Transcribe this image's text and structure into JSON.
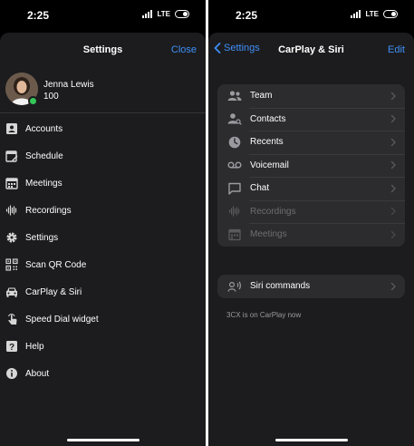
{
  "status_bar": {
    "time": "2:25",
    "network": "LTE"
  },
  "left_screen": {
    "title": "Settings",
    "close_label": "Close",
    "profile": {
      "name": "Jenna Lewis",
      "extension": "100",
      "presence": "available"
    },
    "menu": [
      {
        "label": "Accounts",
        "icon": "accounts-icon"
      },
      {
        "label": "Schedule",
        "icon": "schedule-icon"
      },
      {
        "label": "Meetings",
        "icon": "meetings-icon"
      },
      {
        "label": "Recordings",
        "icon": "recordings-icon"
      },
      {
        "label": "Settings",
        "icon": "gear-icon"
      },
      {
        "label": "Scan QR Code",
        "icon": "qr-code-icon"
      },
      {
        "label": "CarPlay & Siri",
        "icon": "car-icon"
      },
      {
        "label": "Speed Dial widget",
        "icon": "tap-icon"
      },
      {
        "label": "Help",
        "icon": "help-icon"
      },
      {
        "label": "About",
        "icon": "info-icon"
      }
    ]
  },
  "right_screen": {
    "back_label": "Settings",
    "title": "CarPlay & Siri",
    "edit_label": "Edit",
    "features": [
      {
        "label": "Team",
        "icon": "team-icon",
        "enabled": true
      },
      {
        "label": "Contacts",
        "icon": "contacts-icon",
        "enabled": true
      },
      {
        "label": "Recents",
        "icon": "clock-icon",
        "enabled": true
      },
      {
        "label": "Voicemail",
        "icon": "voicemail-icon",
        "enabled": true
      },
      {
        "label": "Chat",
        "icon": "chat-icon",
        "enabled": true
      },
      {
        "label": "Recordings",
        "icon": "recordings-icon",
        "enabled": false
      },
      {
        "label": "Meetings",
        "icon": "meetings-icon",
        "enabled": false
      }
    ],
    "siri_commands_label": "Siri commands",
    "carplay_note": "3CX is on CarPlay now"
  },
  "colors": {
    "accent": "#3f8ff7",
    "background": "#1c1c1e",
    "grouped_cell": "#2c2c2e",
    "presence_green": "#34c759"
  }
}
